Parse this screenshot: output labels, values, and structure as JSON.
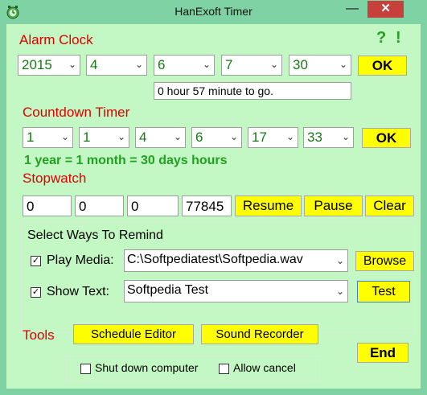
{
  "window": {
    "title": "HanExoft Timer",
    "minimize_glyph": "—",
    "close_glyph": "✕"
  },
  "help": {
    "question": "?",
    "exclaim": "!"
  },
  "alarm": {
    "label": "Alarm Clock",
    "year": "2015",
    "month": "4",
    "day": "6",
    "hour": "7",
    "minute": "30",
    "ok_label": "OK",
    "status": "0 hour 57 minute to go."
  },
  "countdown": {
    "label": "Countdown Timer",
    "values": [
      "1",
      "1",
      "4",
      "6",
      "17",
      "33"
    ],
    "ok_label": "OK",
    "note": "1 year =  1 month = 30 days  hours"
  },
  "stopwatch": {
    "label": "Stopwatch",
    "fields": [
      "0",
      "0",
      "0",
      "77845"
    ],
    "resume_label": "Resume",
    "pause_label": "Pause",
    "clear_label": "Clear"
  },
  "remind": {
    "group_label": "Select Ways To Remind",
    "play_media_label": "Play Media:",
    "play_media_checked": true,
    "media_path": "C:\\Softpediatest\\Softpedia.wav",
    "browse_label": "Browse",
    "show_text_label": "Show Text:",
    "show_text_checked": true,
    "text_value": "Softpedia Test",
    "test_label": "Test"
  },
  "tools": {
    "label": "Tools",
    "schedule_label": "Schedule Editor",
    "sound_label": "Sound Recorder",
    "end_label": "End"
  },
  "options": {
    "shutdown_label": "Shut down computer",
    "shutdown_checked": false,
    "allow_cancel_label": "Allow cancel",
    "allow_cancel_checked": false
  },
  "colors": {
    "accent_red": "#e00000",
    "button_yellow": "#ffff00",
    "bg_green": "#c3f7c3",
    "frame_green": "#7fd2a3",
    "text_green": "#22a022"
  },
  "icons": [
    "app-icon",
    "chevron-down-icon",
    "check-icon",
    "close-icon",
    "minimize-icon"
  ]
}
